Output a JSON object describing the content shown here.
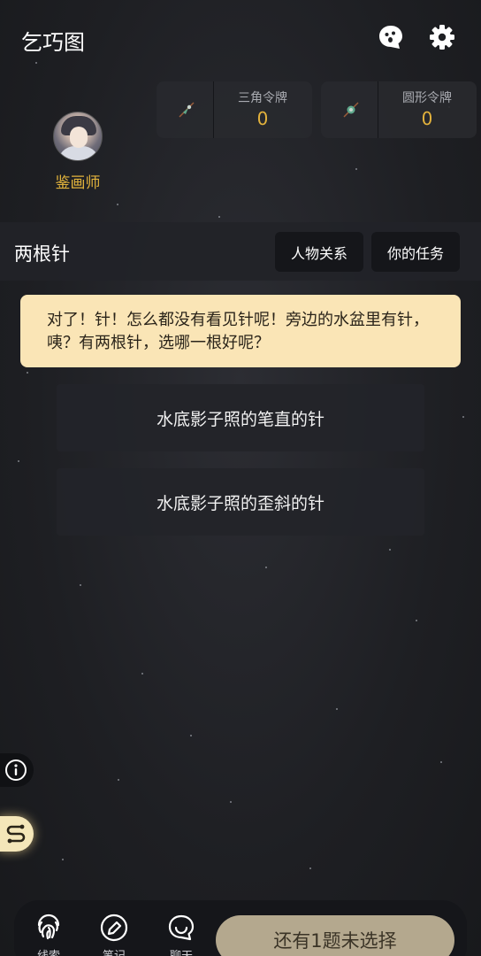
{
  "header": {
    "app_title": "乞巧图",
    "chat_icon": "chat-bubble-face-icon",
    "settings_icon": "gear-icon"
  },
  "profile": {
    "role": "鉴画师",
    "avatar": "avatar"
  },
  "tokens": [
    {
      "label": "三角令牌",
      "count": "0",
      "icon": "triangle-token-icon"
    },
    {
      "label": "圆形令牌",
      "count": "0",
      "icon": "circle-token-icon"
    }
  ],
  "scene": {
    "title": "两根针",
    "relations_label": "人物关系",
    "tasks_label": "你的任务"
  },
  "dialogue": {
    "text": "对了！针！怎么都没有看见针呢！旁边的水盆里有针，咦？有两根针，选哪一根好呢？"
  },
  "options": [
    {
      "label": "水底影子照的笔直的针"
    },
    {
      "label": "水底影子照的歪斜的针"
    }
  ],
  "bottom": {
    "nav": [
      {
        "label": "线索",
        "icon": "fingerprint-icon"
      },
      {
        "label": "笔记",
        "icon": "pencil-icon"
      },
      {
        "label": "聊天",
        "icon": "chat-icon"
      }
    ],
    "submit_label": "还有1题未选择"
  },
  "colors": {
    "accent_gold": "#e3b23c",
    "dialogue_bg": "#fae5b6",
    "submit_bg": "#b4a88e"
  }
}
